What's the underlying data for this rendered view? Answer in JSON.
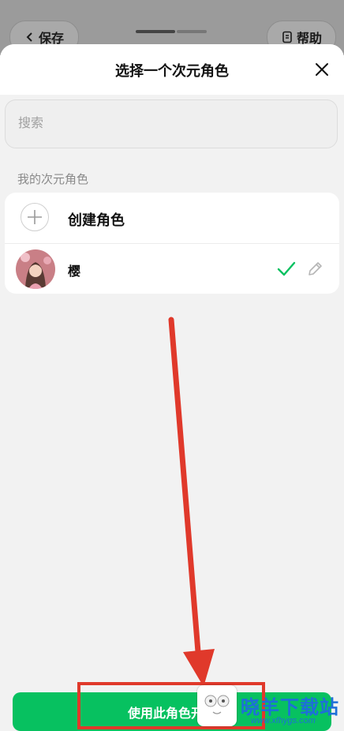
{
  "background": {
    "save_label": "保存",
    "help_label": "帮助"
  },
  "sheet": {
    "title": "选择一个次元角色",
    "search": {
      "placeholder": "搜索",
      "value": ""
    },
    "section_label": "我的次元角色",
    "create_label": "创建角色",
    "characters": [
      {
        "name": "樱",
        "selected": true
      }
    ]
  },
  "bottom": {
    "primary_button_label": "使用此角色开始"
  },
  "watermark": {
    "text": "晓羊下载站",
    "url": "www.xfhygs.com"
  },
  "colors": {
    "accent_green": "#07c160",
    "annotation_red": "#e0392b",
    "watermark_blue": "#1e6fd8"
  },
  "icons": [
    "back-chevron-icon",
    "help-doc-icon",
    "close-icon",
    "plus-icon",
    "checkmark-icon",
    "pencil-icon"
  ]
}
